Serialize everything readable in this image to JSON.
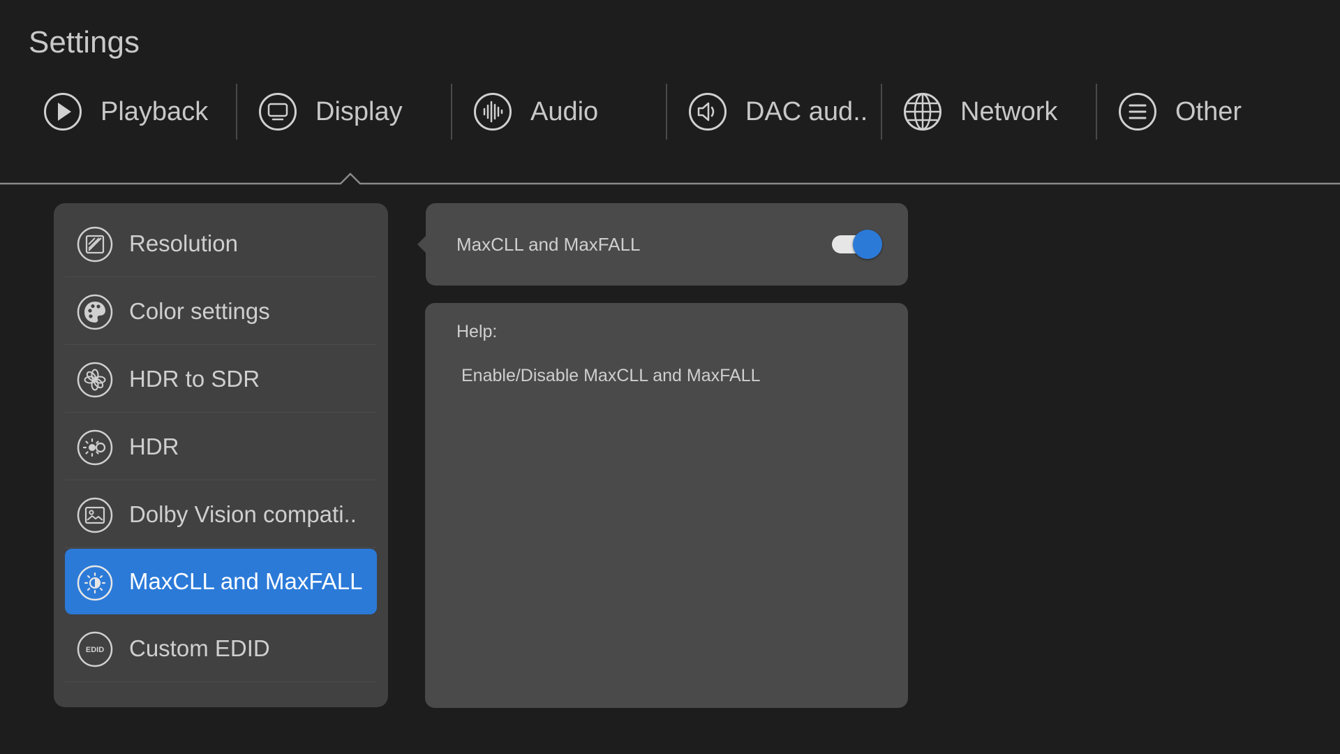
{
  "header": {
    "title": "Settings"
  },
  "tabs": [
    {
      "label": "Playback",
      "icon": "play-icon"
    },
    {
      "label": "Display",
      "icon": "monitor-icon"
    },
    {
      "label": "Audio",
      "icon": "audio-waveform-icon"
    },
    {
      "label": "DAC aud..",
      "icon": "speaker-icon"
    },
    {
      "label": "Network",
      "icon": "globe-icon"
    },
    {
      "label": "Other",
      "icon": "menu-icon"
    }
  ],
  "active_tab": "Display",
  "menu": {
    "items": [
      {
        "label": "Resolution",
        "icon": "resolution-icon"
      },
      {
        "label": "Color settings",
        "icon": "palette-icon"
      },
      {
        "label": "HDR to SDR",
        "icon": "aperture-icon"
      },
      {
        "label": "HDR",
        "icon": "hdr-brightness-icon"
      },
      {
        "label": "Dolby Vision compati..",
        "icon": "image-icon"
      },
      {
        "label": "MaxCLL and MaxFALL",
        "icon": "brightness-icon"
      },
      {
        "label": "Custom EDID",
        "icon": "edid-icon",
        "badge": "EDID"
      }
    ],
    "selected": "MaxCLL and MaxFALL"
  },
  "setting": {
    "label": "MaxCLL and MaxFALL",
    "enabled": true
  },
  "help": {
    "heading": "Help:",
    "text": "Enable/Disable MaxCLL and MaxFALL"
  },
  "colors": {
    "background": "#1d1d1e",
    "panel": "#414142",
    "card": "#4a4a4b",
    "accent": "#2b7ad8",
    "text": "#cfcfcf"
  }
}
